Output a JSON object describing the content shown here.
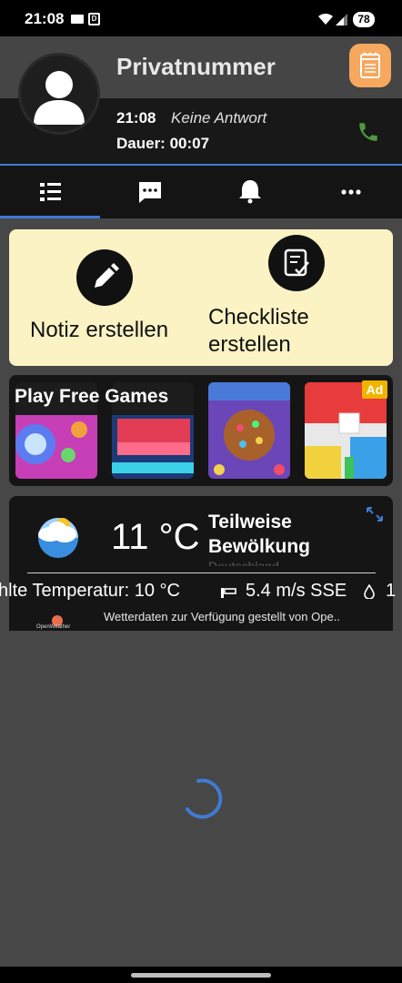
{
  "status_bar": {
    "time": "21:08",
    "calendar_glyph": "D",
    "battery": "78"
  },
  "caller": {
    "name": "Privatnummer",
    "time": "21:08",
    "status": "Keine Antwort",
    "duration": "Dauer: 00:07"
  },
  "tabs": [
    {
      "icon": "list-icon"
    },
    {
      "icon": "message-icon"
    },
    {
      "icon": "bell-icon"
    },
    {
      "icon": "more-icon"
    }
  ],
  "notes_card": {
    "note_label": "Notiz erstellen",
    "checklist_line1": "Checkliste",
    "checklist_line2": "erstellen"
  },
  "games": {
    "title": "Play Free Games",
    "ad_badge": "Ad"
  },
  "weather": {
    "temperature": "11 °C",
    "description_line1": "Teilweise",
    "description_line2": "Bewölkung",
    "location_partial": "Deutschland",
    "details": "hlte Temperatur: 10 °C",
    "wind": "5.4 m/s SSE",
    "humidity": "1",
    "credit": "Wetterdaten zur Verfügung gestellt von Ope..",
    "logo_text": "OpenWeather"
  },
  "colors": {
    "accent": "#3f7bd1",
    "notes_button": "#f5a85e",
    "notes_card": "#fbf3c4",
    "phone_green": "#4c9a3c",
    "ad_badge": "#f0b400"
  }
}
